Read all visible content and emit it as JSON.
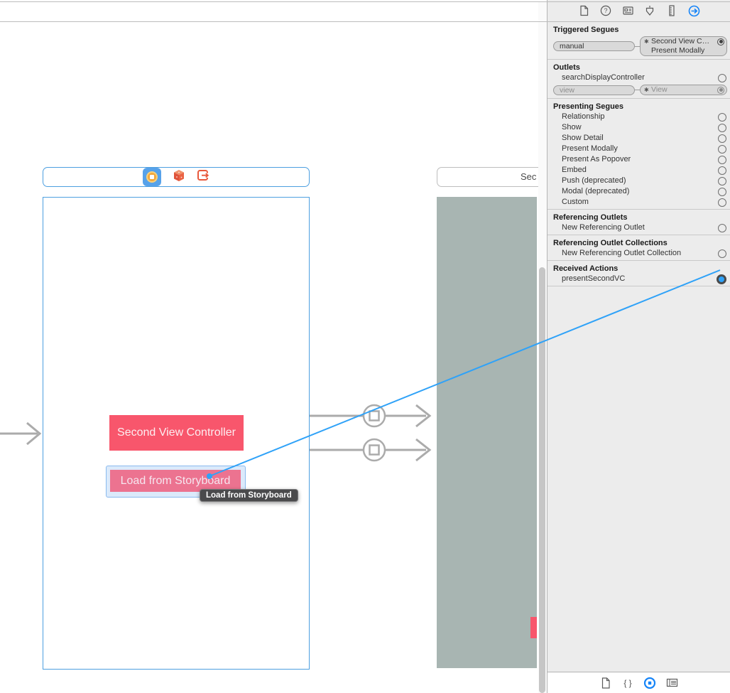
{
  "colors": {
    "accent_blue": "#2fa2f8",
    "selection_blue": "#57a2ea",
    "pink": "#f8566c",
    "view_green": "#a8b5b2",
    "arrow_gray": "#ababab"
  },
  "inspector_tabs": [
    {
      "name": "file-inspector",
      "selected": false
    },
    {
      "name": "quick-help-inspector",
      "selected": false
    },
    {
      "name": "identity-inspector",
      "selected": false
    },
    {
      "name": "attributes-inspector",
      "selected": false
    },
    {
      "name": "size-inspector",
      "selected": false
    },
    {
      "name": "connections-inspector",
      "selected": true
    }
  ],
  "panel": {
    "sections": [
      {
        "title": "Triggered Segues",
        "rows": [
          {
            "type": "connection",
            "pill": "manual",
            "box": {
              "lines": [
                "Second View C…",
                "Present Modally"
              ],
              "asterisk": "✱",
              "radio": "filled"
            }
          }
        ]
      },
      {
        "title": "Outlets",
        "rows": [
          {
            "type": "item",
            "label": "searchDisplayController",
            "circle": "empty"
          },
          {
            "type": "connection",
            "pill": "view",
            "dimmed": true,
            "box": {
              "lines": [
                "View"
              ],
              "asterisk": "✱",
              "radio": "filled"
            }
          }
        ]
      },
      {
        "title": "Presenting Segues",
        "rows": [
          {
            "type": "item",
            "label": "Relationship",
            "circle": "empty"
          },
          {
            "type": "item",
            "label": "Show",
            "circle": "empty"
          },
          {
            "type": "item",
            "label": "Show Detail",
            "circle": "empty"
          },
          {
            "type": "item",
            "label": "Present Modally",
            "circle": "empty"
          },
          {
            "type": "item",
            "label": "Present As Popover",
            "circle": "empty"
          },
          {
            "type": "item",
            "label": "Embed",
            "circle": "empty"
          },
          {
            "type": "item",
            "label": "Push (deprecated)",
            "circle": "empty"
          },
          {
            "type": "item",
            "label": "Modal (deprecated)",
            "circle": "empty"
          },
          {
            "type": "item",
            "label": "Custom",
            "circle": "empty"
          }
        ]
      },
      {
        "title": "Referencing Outlets",
        "rows": [
          {
            "type": "item",
            "label": "New Referencing Outlet",
            "circle": "empty"
          }
        ]
      },
      {
        "title": "Referencing Outlet Collections",
        "rows": [
          {
            "type": "item",
            "label": "New Referencing Outlet Collection",
            "circle": "empty"
          }
        ]
      },
      {
        "title": "Received Actions",
        "rows": [
          {
            "type": "item",
            "label": "presentSecondVC",
            "circle": "active"
          }
        ]
      }
    ]
  },
  "canvas": {
    "vc1": {
      "label": "Second View Controller",
      "button_label": "Load from Storyboard"
    },
    "tooltip": "Load from Storyboard",
    "vc2": {
      "title_truncated": "Sec"
    }
  },
  "library_tabs": [
    {
      "name": "file-template-library",
      "selected": false
    },
    {
      "name": "code-snippet-library",
      "selected": false
    },
    {
      "name": "object-library",
      "selected": true
    },
    {
      "name": "media-library",
      "selected": false
    }
  ]
}
